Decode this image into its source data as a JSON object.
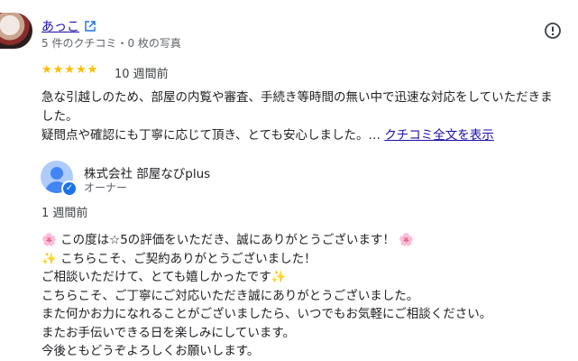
{
  "reviewer": {
    "name": "あっこ",
    "meta": "5 件のクチコミ・0 枚の写真"
  },
  "review": {
    "stars": [
      "★",
      "★",
      "★",
      "★",
      "★"
    ],
    "rating": 5,
    "date": "10 週間前",
    "lines": [
      "急な引越しのため、部屋の内覧や審査、手続き等時間の無い中で迅速な対応をしていただきま",
      "した。",
      "疑問点や確認にも丁寧に応じて頂き、とても安心しました。… "
    ],
    "more_link": "クチコミ全文を表示"
  },
  "owner": {
    "name": "株式会社 部屋なびplus",
    "role": "オーナー",
    "reply_date": "1 週間前",
    "reply_lines": [
      "🌸 この度は☆5の評価をいただき、誠にありがとうございます！ 🌸",
      "✨ こちらこそ、ご契約ありがとうございました！",
      "ご相談いただけて、とても嬉しかったです✨",
      "こちらこそ、ご丁寧にご対応いただき誠にありがとうございました。",
      "また何かお力になれることがございましたら、いつでもお気軽にご相談ください。",
      "またお手伝いできる日を楽しみにしています。",
      "今後ともどうぞよろしくお願いします。"
    ]
  },
  "icons": {
    "external": "external-link-icon",
    "report": "report-flag-icon",
    "verified": "verified-check-icon"
  },
  "colors": {
    "link": "#1a0dab",
    "star": "#fbbc04",
    "verified": "#1a73e8"
  }
}
